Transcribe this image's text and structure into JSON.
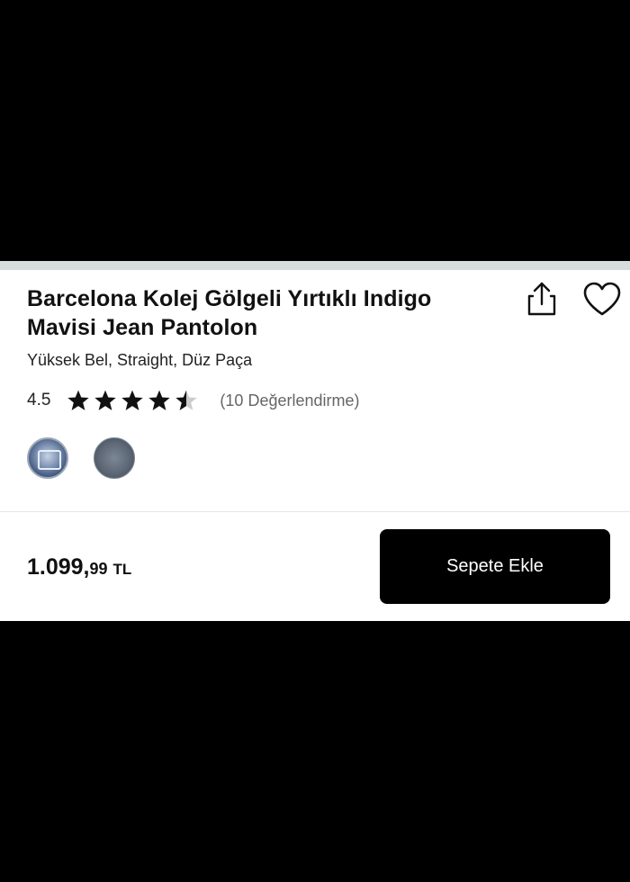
{
  "product": {
    "title": "Barcelona Kolej Gölgeli Yırtıklı Indigo Mavisi Jean Pantolon",
    "subtitle": "Yüksek Bel, Straight, Düz Paça",
    "rating": {
      "score": "4.5",
      "stars_value": 4.5,
      "stars_max": 5,
      "review_count": "(10 Değerlendirme)"
    },
    "swatches": [
      {
        "name": "indigo-light"
      },
      {
        "name": "grey-dark"
      }
    ]
  },
  "actions": {
    "share_icon": "share-icon",
    "favorite_icon": "heart-icon"
  },
  "footer": {
    "price_main": "1.099,",
    "price_decimal": "99",
    "currency": "TL",
    "add_to_cart_label": "Sepete Ekle"
  },
  "colors": {
    "background_outer": "#000000",
    "panel": "#ffffff",
    "text_primary": "#111111",
    "text_muted": "#666666",
    "button_bg": "#000000",
    "button_text": "#ffffff",
    "star_fill": "#111111",
    "star_empty": "#cccccc"
  }
}
